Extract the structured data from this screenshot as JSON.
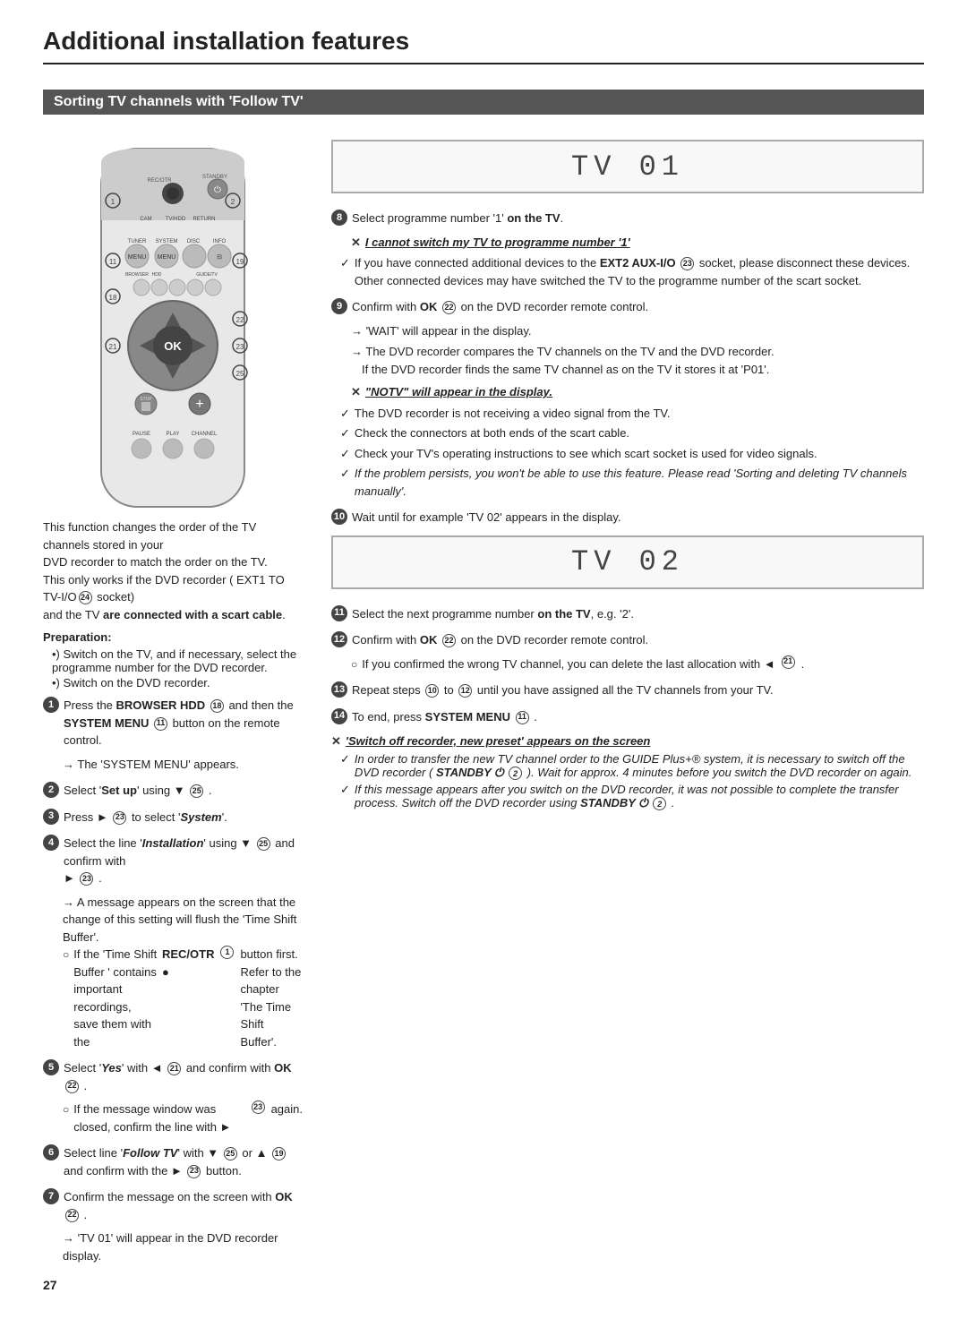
{
  "page": {
    "title": "Additional installation features",
    "section": "Sorting TV channels with 'Follow TV'",
    "page_number": "27"
  },
  "intro": {
    "line1": "This function changes the order of the TV channels stored in your",
    "line2": "DVD recorder to match the order on the TV.",
    "line3": "This only works if the DVD recorder ( EXT1 TO TV-I/O",
    "num24": "24",
    "line3b": " socket)",
    "line4": "and the TV",
    "line4b": "are connected with a scart cable",
    "line4c": "."
  },
  "preparation": {
    "title": "Preparation:",
    "items": [
      "Switch on the TV, and if necessary, select the programme number for the DVD recorder.",
      "Switch on the DVD recorder."
    ]
  },
  "display1": "TV  01",
  "display2": "TV  02",
  "steps": [
    {
      "num": "1",
      "text_parts": [
        {
          "t": "Press the ",
          "b": false
        },
        {
          "t": "BROWSER HDD ",
          "b": true
        },
        {
          "t": "18",
          "circle": true
        },
        {
          "t": " and then the ",
          "b": false
        },
        {
          "t": "SYSTEM MENU ",
          "b": true
        },
        {
          "t": "11",
          "circle": true
        },
        {
          "t": " button on the remote control.",
          "b": false
        }
      ],
      "arrow": "The 'SYSTEM MENU' appears."
    },
    {
      "num": "2",
      "text_parts": [
        {
          "t": "Select '",
          "b": false
        },
        {
          "t": "Set up",
          "b": true
        },
        {
          "t": "' using ▼ ",
          "b": false
        },
        {
          "t": "25",
          "circle": true
        },
        {
          "t": " .",
          "b": false
        }
      ]
    },
    {
      "num": "3",
      "text_parts": [
        {
          "t": "Press ► ",
          "b": false
        },
        {
          "t": "23",
          "circle": true
        },
        {
          "t": " to select '",
          "b": false
        },
        {
          "t": "System",
          "b": true,
          "i": true
        },
        {
          "t": "'.",
          "b": false
        }
      ]
    },
    {
      "num": "4",
      "text_parts": [
        {
          "t": "Select the line '",
          "b": false
        },
        {
          "t": "Installation",
          "b": true,
          "i": true
        },
        {
          "t": "' using ▼ ",
          "b": false
        },
        {
          "t": "25",
          "circle": true
        },
        {
          "t": " and confirm with",
          "b": false
        }
      ],
      "text2": "► 23 .",
      "arrow": "A message appears on the screen that the change of this setting will flush the 'Time Shift Buffer'.",
      "bullet_o": "If the 'Time Shift Buffer ' contains important recordings, save them with the REC/OTR ● 1 button first. Refer to the chapter 'The Time Shift Buffer'."
    },
    {
      "num": "5",
      "text_parts": [
        {
          "t": "Select '",
          "b": false
        },
        {
          "t": "Yes",
          "b": true,
          "i": true
        },
        {
          "t": "' with ◄ ",
          "b": false
        },
        {
          "t": "21",
          "circle": true
        },
        {
          "t": " and confirm with ",
          "b": false
        },
        {
          "t": "OK ",
          "b": true
        },
        {
          "t": "22",
          "circle": true
        },
        {
          "t": " .",
          "b": false
        }
      ],
      "bullet_o": "If the message window was closed, confirm the line with ► 23 again."
    },
    {
      "num": "6",
      "text_parts": [
        {
          "t": "Select line '",
          "b": false
        },
        {
          "t": "Follow TV",
          "b": true,
          "i": true
        },
        {
          "t": "' with ▼ ",
          "b": false
        },
        {
          "t": "25",
          "circle": true
        },
        {
          "t": " or ▲ ",
          "b": false
        },
        {
          "t": "19",
          "circle": true
        },
        {
          "t": " and confirm with",
          "b": false
        }
      ],
      "text2": "the ► 23 button."
    },
    {
      "num": "7",
      "text_parts": [
        {
          "t": "Confirm the message on the screen with ",
          "b": false
        },
        {
          "t": "OK ",
          "b": true
        },
        {
          "t": "22",
          "circle": true
        },
        {
          "t": " .",
          "b": false
        }
      ],
      "arrow": "'TV  01' will appear in the DVD recorder display."
    }
  ],
  "right_steps": [
    {
      "num": "8",
      "text_parts": [
        {
          "t": "Select programme number '1' ",
          "b": false
        },
        {
          "t": "on the TV",
          "b": true
        },
        {
          "t": ".",
          "b": false
        }
      ],
      "note_x": {
        "sym": "✕",
        "text_bold_italic": "I cannot switch my TV to programme number '1'",
        "checks": [
          {
            "text": "If you have connected additional devices to the EXT2 AUX-I/O 23 socket, please disconnect these devices. Other connected devices may have switched the TV to the programme number of the scart socket.",
            "num": "23"
          }
        ]
      }
    },
    {
      "num": "9",
      "text_parts": [
        {
          "t": "Confirm with ",
          "b": false
        },
        {
          "t": "OK ",
          "b": true
        },
        {
          "t": "22",
          "circle": true
        },
        {
          "t": " on the DVD recorder remote control.",
          "b": false
        }
      ],
      "arrows": [
        "'WAIT' will appear in the display.",
        "The DVD recorder compares the TV channels on the TV and the DVD recorder. If the DVD recorder finds the same TV channel as on the TV it stores it at 'P01'."
      ],
      "note_x2": {
        "sym": "✕",
        "text_bold_underline": "'NOTV' will appear in the display.",
        "checks": [
          "The DVD recorder is not receiving a video signal from the TV.",
          "Check the connectors at both ends of the scart cable.",
          "Check your TV's operating instructions to see which scart socket is used for video signals.",
          "If the problem persists, you won't be able to use this feature. Please read 'Sorting and deleting TV channels manually'."
        ]
      }
    },
    {
      "num": "10",
      "text_parts": [
        {
          "t": "Wait until for example 'TV  02' appears in the display.",
          "b": false
        }
      ]
    },
    {
      "num": "11",
      "text_parts": [
        {
          "t": "Select the next programme number ",
          "b": false
        },
        {
          "t": "on the TV",
          "b": true
        },
        {
          "t": ", e.g. '2'.",
          "b": false
        }
      ]
    },
    {
      "num": "12",
      "text_parts": [
        {
          "t": "Confirm with ",
          "b": false
        },
        {
          "t": "OK ",
          "b": true
        },
        {
          "t": "22",
          "circle": true
        },
        {
          "t": " on the DVD recorder remote control.",
          "b": false
        }
      ],
      "bullet_o": "If you confirmed the wrong TV channel, you can delete the last allocation with ◄ 21 ."
    },
    {
      "num": "13",
      "text_parts": [
        {
          "t": "Repeat steps ",
          "b": false
        },
        {
          "t": "10",
          "circle": true
        },
        {
          "t": " to ",
          "b": false
        },
        {
          "t": "12",
          "circle": true
        },
        {
          "t": " until you have assigned all the TV channels from your TV.",
          "b": false
        }
      ]
    },
    {
      "num": "14",
      "text_parts": [
        {
          "t": "To end, press ",
          "b": false
        },
        {
          "t": "SYSTEM MENU ",
          "b": true
        },
        {
          "t": "11",
          "circle": true
        },
        {
          "t": " .",
          "b": false
        }
      ]
    }
  ],
  "final_note": {
    "sym": "✕",
    "title_bold_italic_underline": "'Switch off recorder, new preset' appears on the screen",
    "checks": [
      "In order to transfer the new TV channel order to the GUIDE Plus+® system, it is necessary to switch off the DVD recorder ( STANDBY ⏻ 2 ). Wait for approx. 4 minutes before you switch the DVD recorder on again.",
      "If this message appears after you switch on the DVD recorder, it was not possible to complete the transfer process. Switch off the DVD recorder using STANDBY ⏻ 2 ."
    ]
  }
}
